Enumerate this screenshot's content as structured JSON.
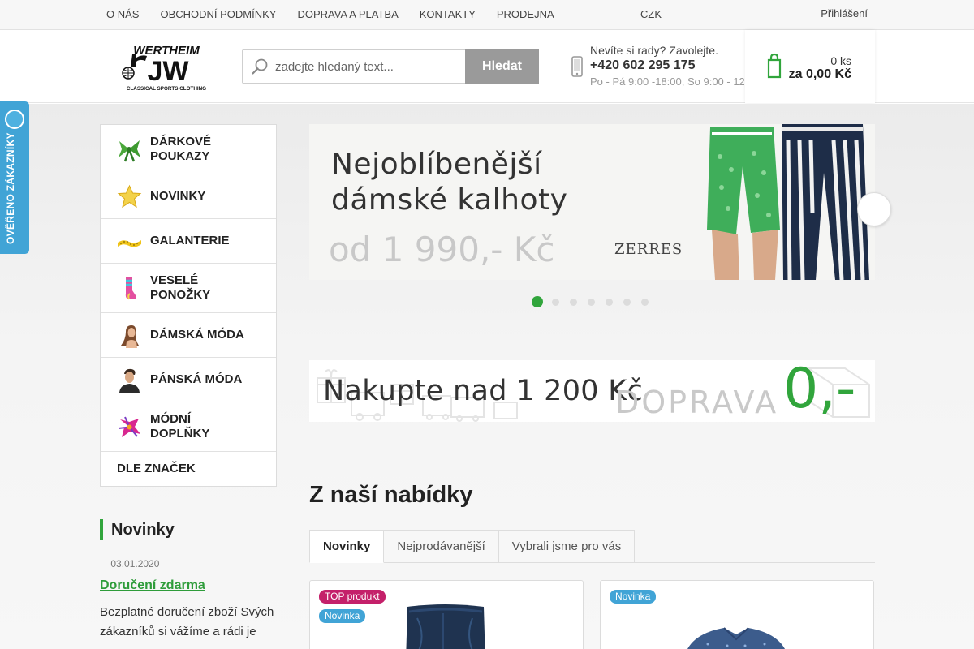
{
  "colors": {
    "accent": "#31a53c",
    "top_badge": "#c4206a",
    "new_badge": "#41a4d6",
    "verified": "#41a4d6"
  },
  "topbar": {
    "nav": [
      "O NÁS",
      "OBCHODNÍ PODMÍNKY",
      "DOPRAVA A PLATBA",
      "KONTAKTY",
      "PRODEJNA"
    ],
    "currency_icon": "",
    "currency": "CZK",
    "currency_caret": "",
    "login_icon": "",
    "login": "Přihlášení"
  },
  "header": {
    "logo_icon": "wertheim-logo",
    "logo_text": "WERTHEIM",
    "logo_sub": "CLASSICAL SPORTS CLOTHING",
    "search": {
      "placeholder": "zadejte hledaný text...",
      "button": "Hledat",
      "icon": "search-icon"
    },
    "help": {
      "icon": "phone-icon",
      "line1": "Nevíte si rady? Zavolejte.",
      "phone": "+420 602 295 175",
      "hours": "Po - Pá 9:00 -18:00, So 9:00 - 12"
    },
    "cart": {
      "icon": "cart-icon",
      "count": "0 ks",
      "total": "za 0,00 Kč"
    }
  },
  "verified_badge": {
    "text": "OVĚŘENO ZÁKAZNÍKY",
    "icon": "verified-seal-icon"
  },
  "sidebar": {
    "items": [
      {
        "label": "DÁRKOVÉ POUKAZY",
        "icon": "gift-bow-icon",
        "arrow": ""
      },
      {
        "label": "NOVINKY",
        "icon": "star-icon",
        "arrow": ""
      },
      {
        "label": "GALANTERIE",
        "icon": "measuring-tape-icon",
        "arrow": ""
      },
      {
        "label": "VESELÉ PONOŽKY",
        "icon": "sock-icon",
        "arrow": ""
      },
      {
        "label": "DÁMSKÁ MÓDA",
        "icon": "woman-icon",
        "arrow": ""
      },
      {
        "label": "PÁNSKÁ MÓDA",
        "icon": "man-icon",
        "arrow": ""
      },
      {
        "label": "MÓDNÍ DOPLŇKY",
        "icon": "flower-icon",
        "arrow": ""
      },
      {
        "label": "DLE ZNAČEK",
        "icon": "",
        "arrow": ""
      }
    ]
  },
  "news": {
    "title": "Novinky",
    "date_icon": "",
    "date": "03.01.2020",
    "link": "Doručení zdarma",
    "text": "Bezplatné doručení zboží Svých zákazníků si vážíme a rádi je"
  },
  "banner": {
    "headline_1": "Nejoblíbenější",
    "headline_2": "dámské kalhoty",
    "price": "od 1 990,- Kč",
    "brand": "ZERRES",
    "next_icon": "",
    "slides": 7,
    "active_slide": 1
  },
  "shipping_banner": {
    "text": "Nakupte nad 1 200 Kč",
    "word": "DOPRAVA",
    "price": "0,-"
  },
  "offers": {
    "title": "Z naší nabídky",
    "tabs": [
      "Novinky",
      "Nejprodávanější",
      "Vybrali jsme pro vás"
    ],
    "active_tab": 0,
    "cards": [
      {
        "badges": [
          "TOP produkt",
          "Novinka"
        ],
        "image": "jeans-image"
      },
      {
        "badges": [
          "Novinka"
        ],
        "image": "shirt-image"
      }
    ]
  }
}
